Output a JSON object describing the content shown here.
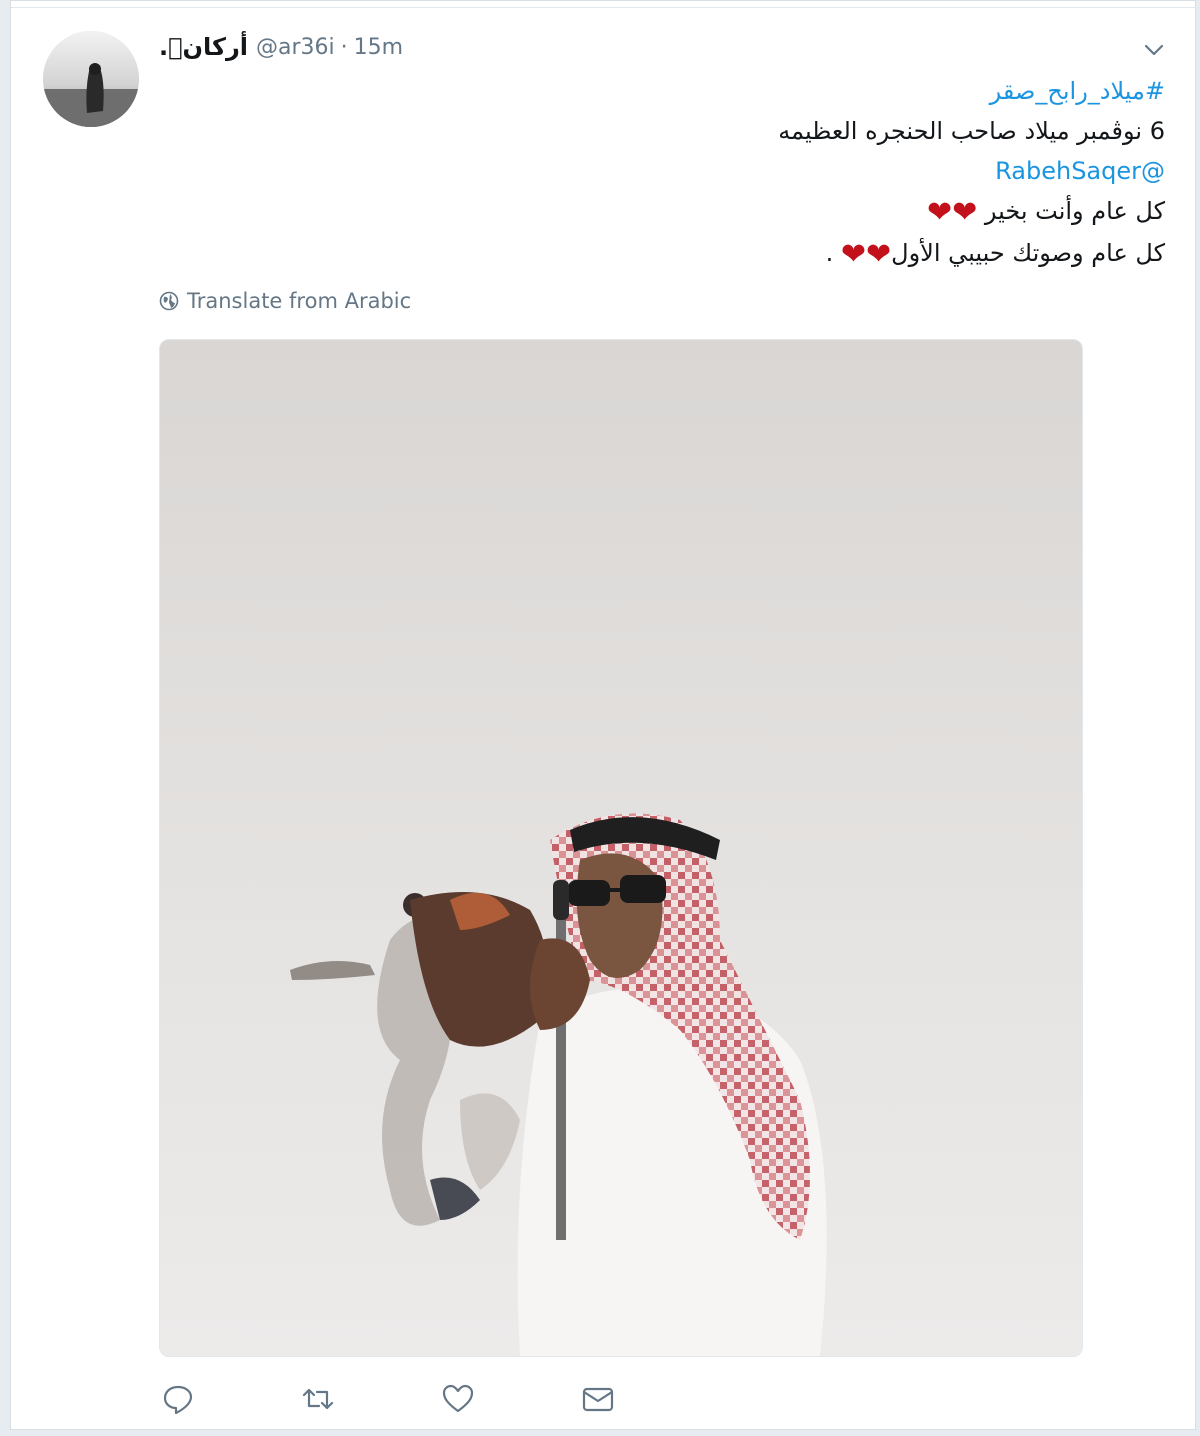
{
  "tweet": {
    "display_name": ".􀀀أركان",
    "handle": "@ar36i",
    "separator": "·",
    "time": "15m",
    "lines": [
      {
        "text": "#ميلاد_رابح_صقر",
        "type": "hashtag"
      },
      {
        "text": "6 نوڤمبر ميلاد صاحب الحنجره العظيمه",
        "type": "text"
      },
      {
        "text": "@RabehSaqer",
        "type": "mention"
      },
      {
        "text": "كل عام وأنت بخير",
        "type": "text",
        "hearts": "❤❤"
      },
      {
        "text": "كل عام وصوتك حبيبي الأول",
        "type": "text",
        "hearts": "❤❤",
        "suffix": "."
      }
    ],
    "translate_label": "Translate from Arabic"
  },
  "icons": {
    "caret": "chevron-down-icon",
    "globe": "globe-icon",
    "reply": "reply-icon",
    "retweet": "retweet-icon",
    "like": "heart-icon",
    "dm": "envelope-icon"
  },
  "colors": {
    "link": "#1b95e0",
    "secondary_text": "#657786",
    "heart": "#c2111b",
    "background": "#e6ecf0"
  }
}
